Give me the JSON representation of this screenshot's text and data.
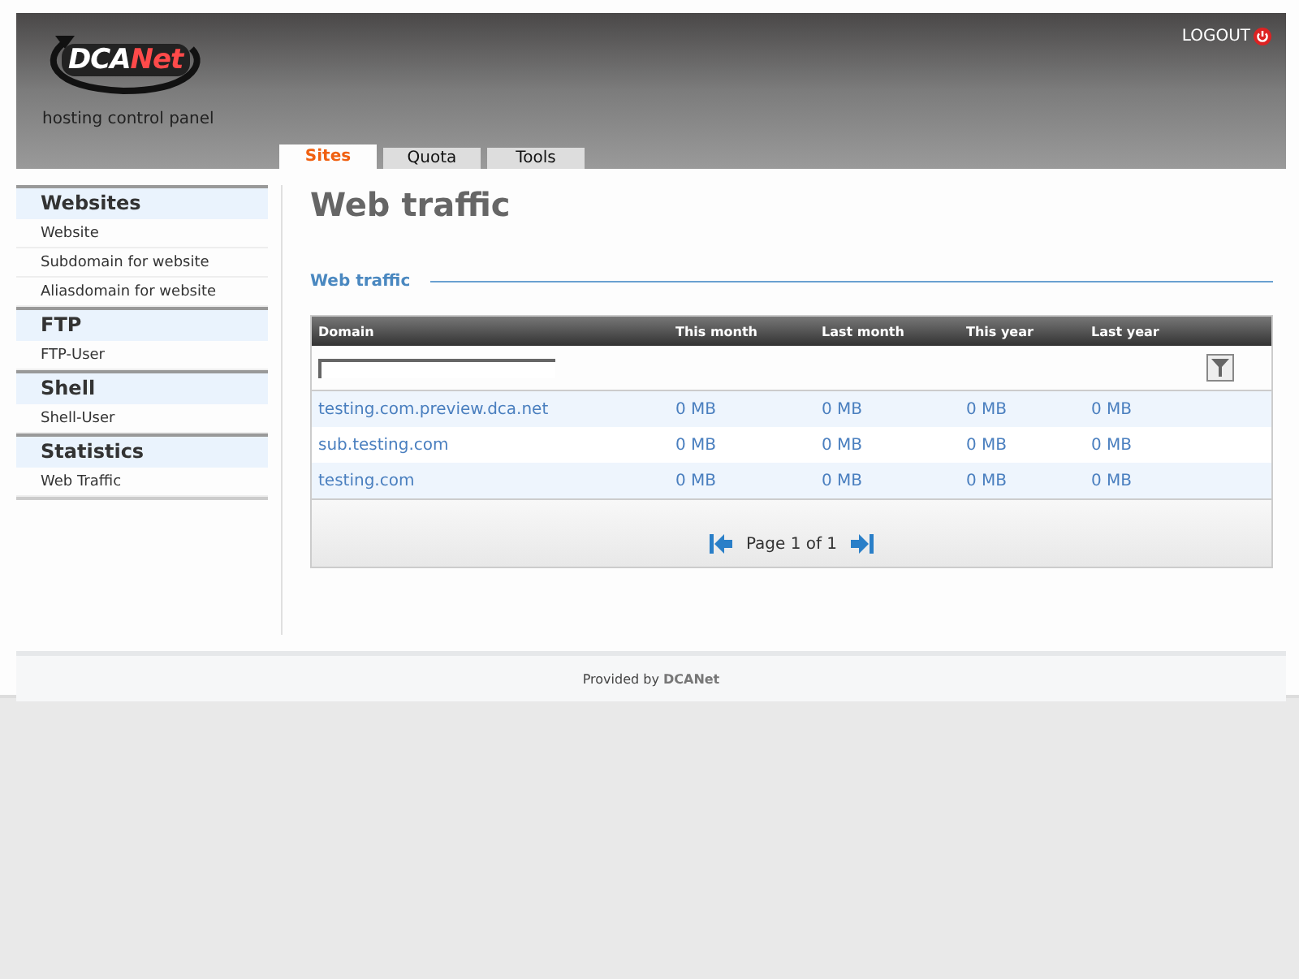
{
  "header": {
    "logo": {
      "part_1": "DCA",
      "part_2": "Net"
    },
    "subtitle": "hosting control panel",
    "logout": "LOGOUT"
  },
  "tabs": [
    {
      "label": "Sites",
      "selected": true
    },
    {
      "label": "Quota",
      "selected": false
    },
    {
      "label": "Tools",
      "selected": false
    }
  ],
  "sidebar": [
    {
      "title": "Websites",
      "items": [
        "Website",
        "Subdomain for website",
        "Aliasdomain for website"
      ]
    },
    {
      "title": "FTP",
      "items": [
        "FTP-User"
      ]
    },
    {
      "title": "Shell",
      "items": [
        "Shell-User"
      ]
    },
    {
      "title": "Statistics",
      "items": [
        "Web Traffic"
      ]
    }
  ],
  "page_title": "Web traffic",
  "section_title": "Web traffic",
  "table": {
    "columns": [
      "Domain",
      "This month",
      "Last month",
      "This year",
      "Last year"
    ],
    "rows": [
      [
        "testing.com.preview.dca.net",
        "0 MB",
        "0 MB",
        "0 MB",
        "0 MB"
      ],
      [
        "sub.testing.com",
        "0 MB",
        "0 MB",
        "0 MB",
        "0 MB"
      ],
      [
        "testing.com",
        "0 MB",
        "0 MB",
        "0 MB",
        "0 MB"
      ]
    ],
    "pager": "Page 1 of 1"
  },
  "footer": {
    "text": "Provided by",
    "brand": "DCANet"
  }
}
